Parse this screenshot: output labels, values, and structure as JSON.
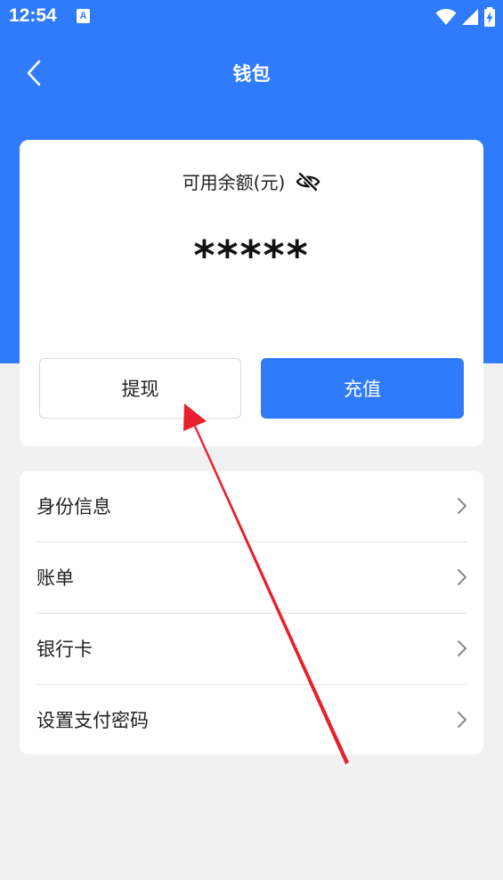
{
  "status_bar": {
    "time": "12:54",
    "notification_icon_letter": "A",
    "icons": [
      "wifi-icon",
      "signal-icon",
      "battery-charging-icon"
    ]
  },
  "header": {
    "title": "钱包",
    "back_icon": "chevron-left-icon"
  },
  "balance_card": {
    "label": "可用余额(元)",
    "visibility_icon": "eye-hidden-icon",
    "value": "*****",
    "withdraw_label": "提现",
    "recharge_label": "充值"
  },
  "menu": {
    "items": [
      {
        "label": "身份信息"
      },
      {
        "label": "账单"
      },
      {
        "label": "银行卡"
      },
      {
        "label": "设置支付密码"
      }
    ]
  },
  "colors": {
    "primary": "#2f7bfc",
    "page_background": "#f1f1f1",
    "annotation_arrow": "#e8202e"
  }
}
